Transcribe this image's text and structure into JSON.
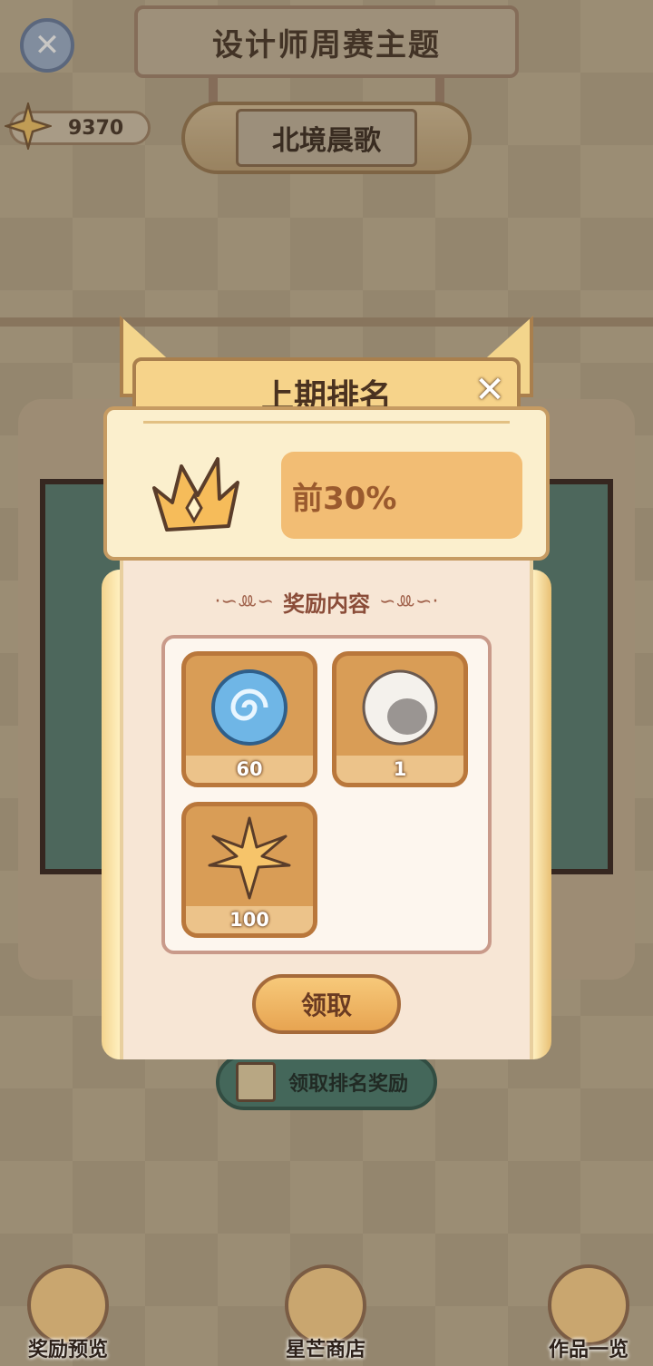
{
  "header": {
    "title": "设计师周赛主题",
    "theme_name": "北境晨歌",
    "currency_value": "9370"
  },
  "background": {
    "rank_reward_button_label": "领取排名奖励"
  },
  "modal": {
    "title": "上期排名",
    "rank_value": "前30%",
    "rewards_title": "奖励内容",
    "rewards": [
      {
        "icon": "blue-swirl-orb-icon",
        "count": "60"
      },
      {
        "icon": "white-haired-avatar-icon",
        "count": "1"
      },
      {
        "icon": "gold-star-icon",
        "count": "100"
      }
    ],
    "claim_label": "领取"
  },
  "bottom_nav": {
    "items": [
      {
        "label": "奖励预览",
        "icon": "trophy-icon"
      },
      {
        "label": "星芒商店",
        "icon": "star-shop-icon"
      },
      {
        "label": "作品一览",
        "icon": "book-icon"
      }
    ]
  },
  "colors": {
    "modal_header": "#f6d38a",
    "rank_value_bg": "#f2bd74",
    "item_bg": "#d99d56",
    "rank_text": "#9a5a2e"
  }
}
